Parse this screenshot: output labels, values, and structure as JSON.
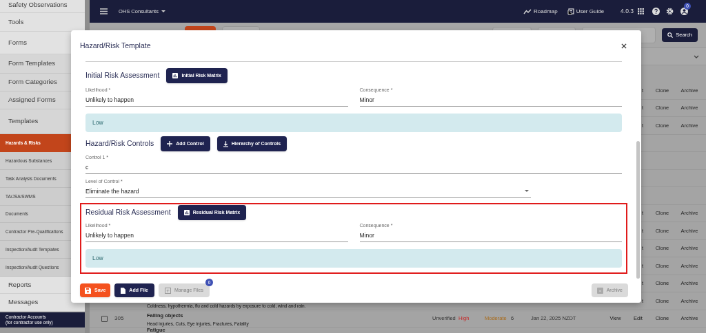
{
  "sidebar": {
    "items": [
      {
        "label": "Safety Observations",
        "kind": "main",
        "selected": false
      },
      {
        "label": "Tools",
        "kind": "main",
        "selected": false
      },
      {
        "label": "Forms",
        "kind": "main",
        "selected": false
      },
      {
        "label": "Form Templates",
        "kind": "sub",
        "selected": false
      },
      {
        "label": "Form Categories",
        "kind": "sub",
        "selected": false
      },
      {
        "label": "Assigned Forms",
        "kind": "sub",
        "selected": false
      },
      {
        "label": "Templates",
        "kind": "sub",
        "selected": false
      },
      {
        "label": "Hazards & Risks",
        "kind": "small",
        "selected": true
      },
      {
        "label": "Hazardous Substances",
        "kind": "small",
        "selected": false
      },
      {
        "label": "Task Analysis Documents",
        "kind": "small",
        "selected": false
      },
      {
        "label": "TA/JSA/SWMS",
        "kind": "small",
        "selected": false
      },
      {
        "label": "Documents",
        "kind": "small",
        "selected": false
      },
      {
        "label": "Contractor Pre-Qualifications",
        "kind": "small",
        "selected": false
      },
      {
        "label": "Inspection/Audit Templates",
        "kind": "small",
        "selected": false
      },
      {
        "label": "Inspection/Audit Questions",
        "kind": "small",
        "selected": false
      },
      {
        "label": "Reports",
        "kind": "main",
        "selected": false
      },
      {
        "label": "Messages",
        "kind": "main",
        "selected": false
      }
    ],
    "footer": [
      "Contractor Accounts",
      "(for contractor use only)"
    ]
  },
  "topbar": {
    "organization": "OHS Consultants",
    "links": [
      "Roadmap",
      "User Guide"
    ],
    "version": "4.0.3",
    "notification_count": "0"
  },
  "toolbar": {
    "search_button": "Search"
  },
  "table": {
    "rows": [
      {
        "actions": [
          "t",
          "Clone",
          "Archive"
        ]
      },
      {
        "actions": [
          "t",
          "Clone",
          "Archive"
        ]
      },
      {
        "actions": [
          "t",
          "Clone",
          "Archive"
        ]
      },
      {
        "actions": []
      },
      {
        "actions": []
      },
      {
        "actions": []
      },
      {
        "actions": []
      },
      {
        "actions": [
          "t",
          "Clone",
          "Archive"
        ]
      },
      {
        "actions": [
          "t",
          "Clone",
          "Archive"
        ]
      },
      {
        "actions": [
          "t",
          "Clone",
          "Archive"
        ]
      },
      {
        "actions": [
          "t",
          "Clone",
          "Archive"
        ]
      },
      {
        "actions": [
          "t",
          "Clone",
          "Archive"
        ]
      },
      {
        "actions": [
          "t",
          "Clone",
          "Archive"
        ],
        "description": "Coldness, hypothermia, flu and cold hazards by exposure to cold, wind and rain."
      },
      {
        "checked": false,
        "number": "305",
        "title": "Falling objects",
        "description": "Head injuries, Cuts, Eye injuries, Fractures, Fatality",
        "status": "Unverified",
        "initial_risk": "High",
        "residual_risk": "Moderate",
        "score": "6",
        "date": "Jan 22, 2025 NZDT",
        "actions": [
          "View",
          "Edit",
          "Clone",
          "Archive"
        ]
      },
      {
        "title": "Fatigue"
      }
    ]
  },
  "dialog": {
    "title": "Hazard/Risk Template",
    "sections": [
      {
        "kind": "assessment",
        "heading": "Initial Risk Assessment",
        "button": "Initial Risk Matrix",
        "highlighted": false,
        "likelihood_label": "Likelihood *",
        "likelihood": "Unlikely to happen",
        "consequence_label": "Consequence *",
        "consequence": "Minor",
        "rating": "Low"
      },
      {
        "kind": "controls",
        "heading": "Hazard/Risk Controls",
        "buttons": [
          "Add Control",
          "Hierarchy of Controls"
        ],
        "control_label": "Control 1 *",
        "control": "c",
        "level_label": "Level of Control *",
        "level": "Eliminate the hazard"
      },
      {
        "kind": "assessment",
        "heading": "Residual Risk Assessment",
        "button": "Residual Risk Matrix",
        "highlighted": true,
        "likelihood_label": "Likelihood *",
        "likelihood": "Unlikely to happen",
        "consequence_label": "Consequence *",
        "consequence": "Minor",
        "rating": "Low"
      }
    ],
    "footer": {
      "save": "Save",
      "add_file": "Add File",
      "manage_files": "Manage Files",
      "manage_disabled": true,
      "files_count": "0",
      "archive": "Archive",
      "archive_disabled": true
    }
  }
}
